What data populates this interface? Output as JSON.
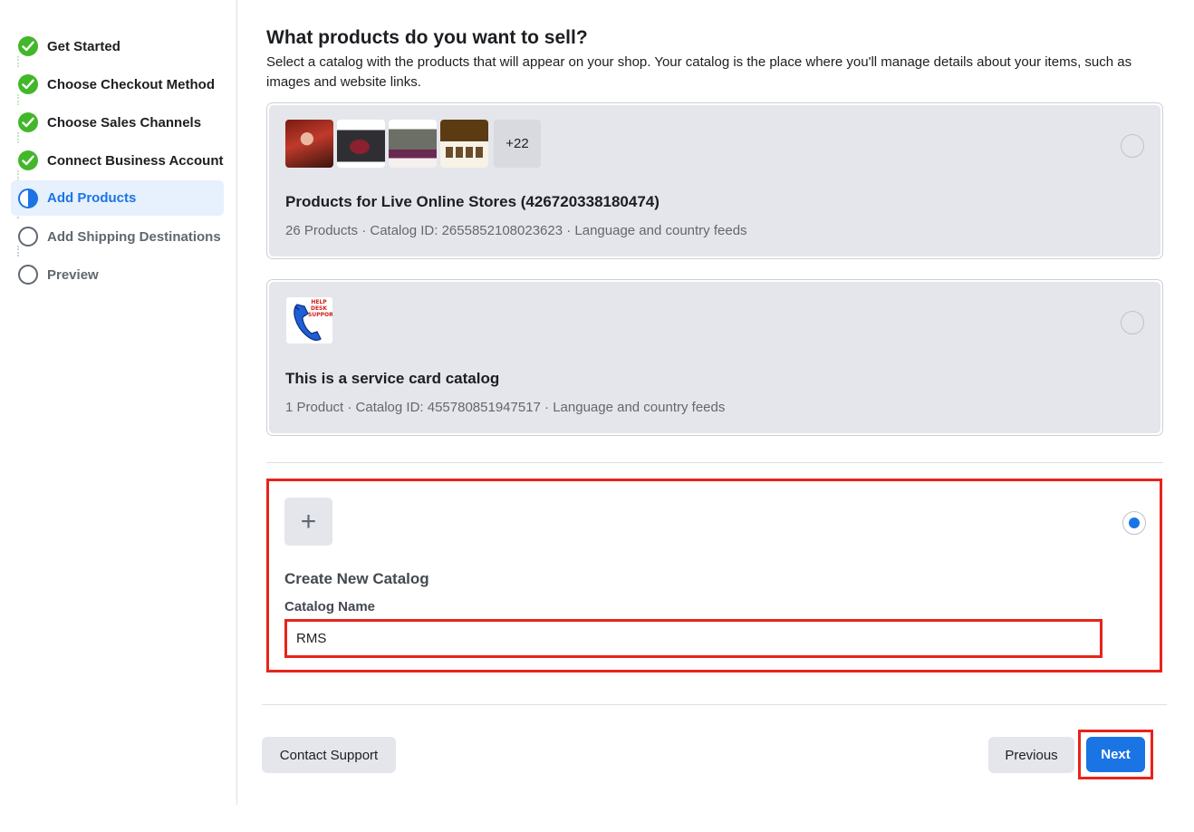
{
  "sidebar": {
    "steps": [
      {
        "label": "Get Started",
        "status": "done"
      },
      {
        "label": "Choose Checkout Method",
        "status": "done"
      },
      {
        "label": "Choose Sales Channels",
        "status": "done"
      },
      {
        "label": "Connect Business Account",
        "status": "done"
      },
      {
        "label": "Add Products",
        "status": "active"
      },
      {
        "label": "Add Shipping Destinations",
        "status": "pending"
      },
      {
        "label": "Preview",
        "status": "pending"
      }
    ]
  },
  "main": {
    "heading": "What products do you want to sell?",
    "description": "Select a catalog with the products that will appear on your shop. Your catalog is the place where you'll manage details about your items, such as images and website links."
  },
  "catalogs": [
    {
      "name": "Products for Live Online Stores (426720338180474)",
      "meta": "26 Products · Catalog ID: 2655852108023623 · Language and country feeds",
      "more_count": "+22",
      "selected": false
    },
    {
      "name": "This is a service card catalog",
      "meta": "1 Product · Catalog ID: 455780851947517 · Language and country feeds",
      "thumb_text": "HELP DESK SUPPORT",
      "selected": false
    }
  ],
  "new_catalog": {
    "plus": "+",
    "title": "Create New Catalog",
    "field_label": "Catalog Name",
    "field_value": "RMS",
    "selected": true
  },
  "footer": {
    "contact_support": "Contact Support",
    "previous": "Previous",
    "next": "Next"
  },
  "colors": {
    "accent": "#1b74e4",
    "success": "#42b72a",
    "highlight": "#e8231a"
  }
}
